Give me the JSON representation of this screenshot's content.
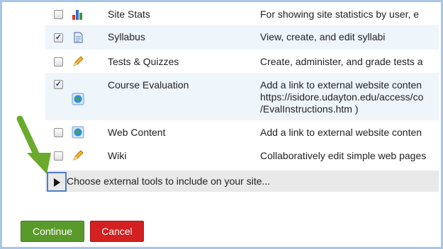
{
  "tools": [
    {
      "name": "Site Stats",
      "icon": "bar-chart-icon",
      "checked": false,
      "desc": [
        "For showing site statistics by user, e"
      ]
    },
    {
      "name": "Syllabus",
      "icon": "document-icon",
      "checked": true,
      "desc": [
        "View, create, and edit syllabi"
      ]
    },
    {
      "name": "Tests & Quizzes",
      "icon": "pencil-icon",
      "checked": false,
      "desc": [
        "Create, administer, and grade tests a"
      ]
    },
    {
      "name": "Course Evaluation",
      "icon": "globe-icon",
      "checked": true,
      "desc": [
        "Add a link to external website conten",
        "https://isidore.udayton.edu/access/co",
        "/EvalInstructions.htm )"
      ]
    },
    {
      "name": "Web Content",
      "icon": "globe-icon",
      "checked": false,
      "desc": [
        "Add a link to external website conten"
      ]
    },
    {
      "name": "Wiki",
      "icon": "pencil-icon",
      "checked": false,
      "desc": [
        "Collaboratively edit simple web pages"
      ]
    }
  ],
  "external_tools": {
    "label": "Choose external tools to include on your site..."
  },
  "buttons": {
    "continue": "Continue",
    "cancel": "Cancel"
  },
  "colors": {
    "continue": "#5a9a2a",
    "cancel": "#d42020",
    "arrow": "#6aaa2c",
    "highlight": "#4e7cc7"
  }
}
